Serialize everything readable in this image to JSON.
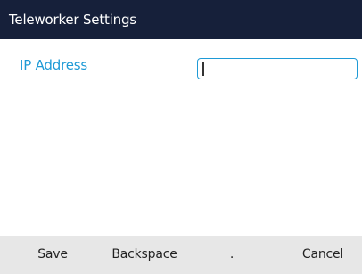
{
  "window": {
    "title": "Teleworker Settings"
  },
  "form": {
    "ip_address": {
      "label": "IP Address",
      "value": "",
      "placeholder": ""
    }
  },
  "softkeys": {
    "save": "Save",
    "backspace": "Backspace",
    "dot": ".",
    "cancel": "Cancel"
  },
  "colors": {
    "title_bar_bg": "#16203a",
    "accent": "#1e9ad6",
    "softkey_bar_bg": "#e7e7e7"
  }
}
